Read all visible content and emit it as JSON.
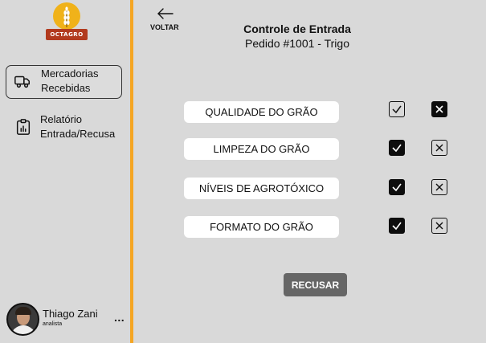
{
  "brand": {
    "name": "OCTAGRO",
    "primary_color": "#f0b21a",
    "banner_color": "#b23a1e"
  },
  "accent_color": "#f5a623",
  "sidebar": {
    "items": [
      {
        "label_line1": "Mercadorias",
        "label_line2": "Recebidas",
        "icon": "truck-icon",
        "active": true
      },
      {
        "label_line1": "Relatório",
        "label_line2": "Entrada/Recusa",
        "icon": "report-icon",
        "active": false
      }
    ]
  },
  "user": {
    "name": "Thiago Zani",
    "role": "analista",
    "more": "..."
  },
  "header": {
    "back_label": "VOLTAR",
    "title": "Controle de Entrada",
    "subtitle": "Pedido #1001 - Trigo"
  },
  "criteria": [
    {
      "label": "QUALIDADE DO GRÃO",
      "approved": false,
      "rejected": true
    },
    {
      "label": "LIMPEZA DO GRÃO",
      "approved": true,
      "rejected": false
    },
    {
      "label": "NÍVEIS DE AGROTÓXICO",
      "approved": true,
      "rejected": false
    },
    {
      "label": "FORMATO DO GRÃO",
      "approved": true,
      "rejected": false
    }
  ],
  "actions": {
    "refuse_label": "RECUSAR"
  }
}
